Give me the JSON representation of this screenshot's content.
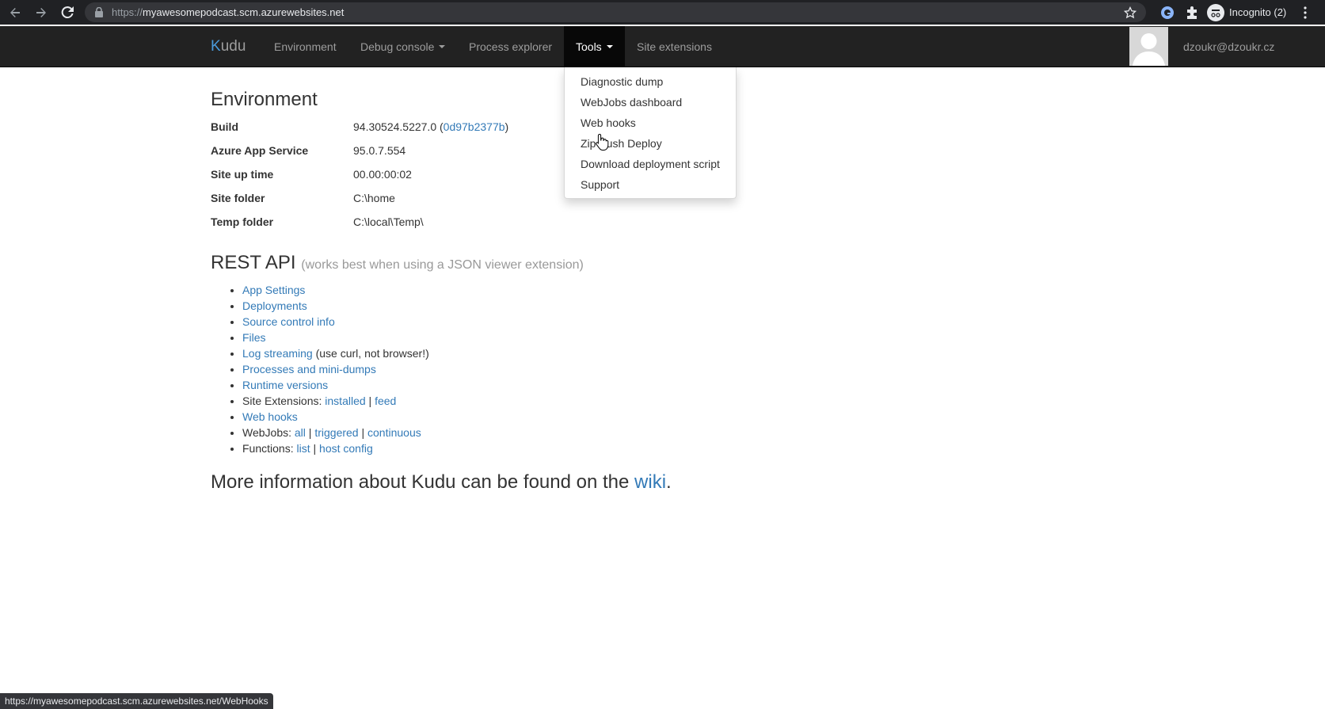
{
  "browser": {
    "url_prefix": "https://",
    "url_host": "myawesomepodcast.scm.azurewebsites.net",
    "incognito_label": "Incognito (2)"
  },
  "navbar": {
    "brand_k": "K",
    "brand_rest": "udu",
    "items": [
      {
        "label": "Environment"
      },
      {
        "label": "Debug console"
      },
      {
        "label": "Process explorer"
      },
      {
        "label": "Tools"
      },
      {
        "label": "Site extensions"
      }
    ],
    "user_email": "dzoukr@dzoukr.cz"
  },
  "tools_menu": {
    "items": [
      {
        "label": "Diagnostic dump"
      },
      {
        "label": "WebJobs dashboard"
      },
      {
        "label": "Web hooks"
      },
      {
        "label": "Zip Push Deploy"
      },
      {
        "label": "Download deployment script"
      },
      {
        "label": "Support"
      }
    ]
  },
  "environment": {
    "title": "Environment",
    "rows": [
      {
        "label": "Build",
        "value": "94.30524.5227.0 (",
        "link": "0d97b2377b",
        "suffix": ")"
      },
      {
        "label": "Azure App Service",
        "value": "95.0.7.554"
      },
      {
        "label": "Site up time",
        "value": "00.00:00:02"
      },
      {
        "label": "Site folder",
        "value": "C:\\home"
      },
      {
        "label": "Temp folder",
        "value": "C:\\local\\Temp\\"
      }
    ]
  },
  "rest_api": {
    "title": "REST API",
    "subtitle": "(works best when using a JSON viewer extension)",
    "items": {
      "app_settings": "App Settings",
      "deployments": "Deployments",
      "source_control": "Source control info",
      "files": "Files",
      "log_streaming": "Log streaming",
      "log_streaming_note": " (use curl, not browser!)",
      "processes": "Processes and mini-dumps",
      "runtime": "Runtime versions",
      "site_ext_prefix": "Site Extensions: ",
      "site_ext_installed": "installed",
      "site_ext_feed": "feed",
      "web_hooks": "Web hooks",
      "webjobs_prefix": "WebJobs: ",
      "webjobs_all": "all",
      "webjobs_triggered": "triggered",
      "webjobs_continuous": "continuous",
      "functions_prefix": "Functions: ",
      "functions_list": "list",
      "functions_host_config": "host config",
      "separator": " | "
    }
  },
  "more_info": {
    "text": "More information about Kudu can be found on the ",
    "link": "wiki",
    "suffix": "."
  },
  "status_bar": {
    "url": "https://myawesomepodcast.scm.azurewebsites.net/WebHooks"
  },
  "colors": {
    "navbar_bg": "#222222",
    "link": "#337ab7",
    "brand_accent": "#4a9bdc"
  }
}
